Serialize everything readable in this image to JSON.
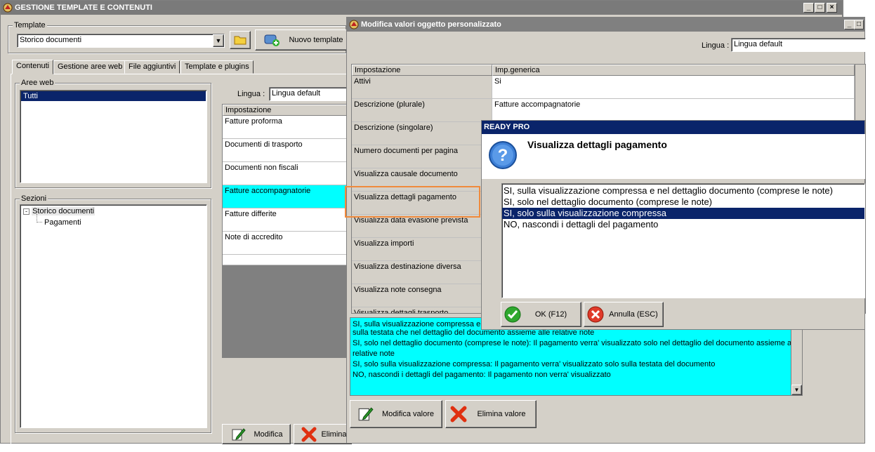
{
  "main_window": {
    "title": "GESTIONE TEMPLATE E CONTENUTI",
    "template_label": "Template",
    "template_value": "Storico documenti",
    "new_template_button": "Nuovo template",
    "tabs": [
      "Contenuti",
      "Gestione aree web",
      "File aggiuntivi",
      "Template e plugins"
    ],
    "aree_web_label": "Aree web",
    "aree_web_items": [
      "Tutti"
    ],
    "sezioni_label": "Sezioni",
    "tree": {
      "root": "Storico documenti",
      "child": "Pagamenti"
    },
    "lingua_label": "Lingua :",
    "lingua_value": "Lingua default",
    "grid_header": "Impostazione",
    "grid_rows": [
      "Fatture proforma",
      "Documenti di trasporto",
      "Documenti non fiscali",
      "Fatture accompagnatorie",
      "Fatture differite",
      "Note di accredito"
    ],
    "modify_button": "Modifica",
    "delete_button": "Elimina"
  },
  "edit_window": {
    "title": "Modifica valori oggetto personalizzato",
    "lingua_label": "Lingua :",
    "lingua_value": "Lingua default",
    "headers": [
      "Impostazione",
      "Imp.generica"
    ],
    "rows": [
      {
        "setting": "Attivi",
        "value": "Si"
      },
      {
        "setting": "Descrizione (plurale)",
        "value": "Fatture accompagnatorie"
      },
      {
        "setting": "Descrizione (singolare)",
        "value": ""
      },
      {
        "setting": "Numero documenti per pagina",
        "value": ""
      },
      {
        "setting": "Visualizza causale documento",
        "value": ""
      },
      {
        "setting": "Visualizza dettagli pagamento",
        "value": ""
      },
      {
        "setting": "Visualizza data evasione prevista",
        "value": ""
      },
      {
        "setting": "Visualizza importi",
        "value": ""
      },
      {
        "setting": "Visualizza destinazione diversa",
        "value": ""
      },
      {
        "setting": "Visualizza note consegna",
        "value": ""
      },
      {
        "setting": "Visualizza dettagli trasporto",
        "value": ""
      }
    ],
    "description_lines": [
      "SI, sulla visualizzazione compressa e",
      "sulla testata che nel dettaglio del documento assieme alle relative note",
      "SI, solo nel dettaglio documento (comprese le note): Il pagamento verra' visualizzato solo nel dettaglio del documento assieme alle",
      "relative note",
      "SI, solo sulla visualizzazione compressa: Il pagamento verra' visualizzato solo sulla testata del documento",
      "NO, nascondi i dettagli del pagamento: Il pagamento non verra' visualizzato"
    ],
    "modify_value_button": "Modifica valore",
    "delete_value_button": "Elimina valore"
  },
  "dialog": {
    "title": "READY PRO",
    "question": "Visualizza dettagli pagamento",
    "options": [
      "SI, sulla visualizzazione compressa e nel dettaglio documento (comprese le note)",
      "SI, solo nel dettaglio documento (comprese le note)",
      "SI, solo sulla visualizzazione compressa",
      "NO, nascondi i dettagli del pagamento"
    ],
    "selected_index": 2,
    "ok_button": "OK (F12)",
    "cancel_button": "Annulla (ESC)"
  },
  "colors": {
    "highlight_cyan": "#00ffff",
    "selection_navy": "#0a246a",
    "callout_orange": "#f08a3c"
  }
}
